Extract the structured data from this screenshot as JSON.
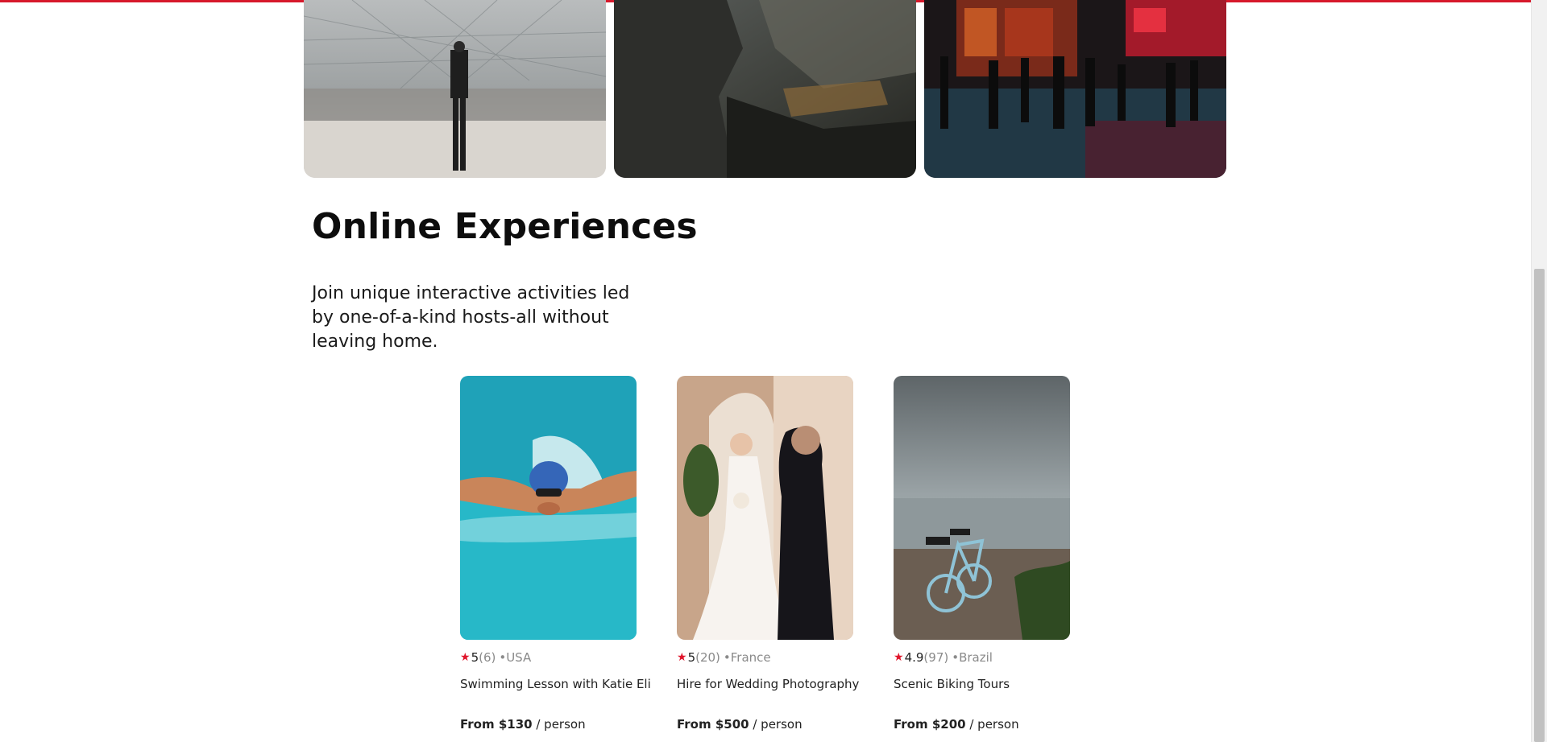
{
  "colors": {
    "accent": "#d7192b",
    "star": "#e0152b",
    "muted": "#8a8a8a"
  },
  "hero_photos": [
    {
      "icon": "photo-louvre-man-walking"
    },
    {
      "icon": "photo-cliff-valley"
    },
    {
      "icon": "photo-night-city-street"
    }
  ],
  "section": {
    "title": "Online Experiences",
    "description": "Join unique interactive activities led by one-of-a-kind hosts-all without leaving home."
  },
  "cards": [
    {
      "rating": "5",
      "reviews": "(6)",
      "country": "•USA",
      "title": "Swimming Lesson with Katie Eli",
      "price": "From $130",
      "unit": " / person",
      "icon": "swimmer-photo"
    },
    {
      "rating": "5",
      "reviews": "(20)",
      "country": "•France",
      "title": "Hire for Wedding Photography",
      "price": "From $500",
      "unit": " / person",
      "icon": "wedding-photo"
    },
    {
      "rating": "4.9",
      "reviews": "(97)",
      "country": "•Brazil",
      "title": "Scenic Biking Tours",
      "price": "From $200",
      "unit": " / person",
      "icon": "bicycle-beach-photo"
    }
  ],
  "star_glyph": "★"
}
